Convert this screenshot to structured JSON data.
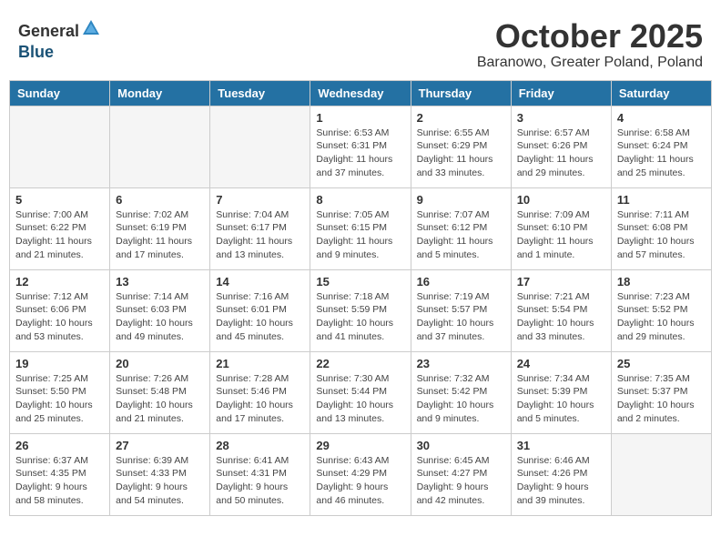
{
  "logo": {
    "general": "General",
    "blue": "Blue"
  },
  "title": "October 2025",
  "subtitle": "Baranowo, Greater Poland, Poland",
  "days_of_week": [
    "Sunday",
    "Monday",
    "Tuesday",
    "Wednesday",
    "Thursday",
    "Friday",
    "Saturday"
  ],
  "weeks": [
    [
      {
        "day": "",
        "info": ""
      },
      {
        "day": "",
        "info": ""
      },
      {
        "day": "",
        "info": ""
      },
      {
        "day": "1",
        "info": "Sunrise: 6:53 AM\nSunset: 6:31 PM\nDaylight: 11 hours\nand 37 minutes."
      },
      {
        "day": "2",
        "info": "Sunrise: 6:55 AM\nSunset: 6:29 PM\nDaylight: 11 hours\nand 33 minutes."
      },
      {
        "day": "3",
        "info": "Sunrise: 6:57 AM\nSunset: 6:26 PM\nDaylight: 11 hours\nand 29 minutes."
      },
      {
        "day": "4",
        "info": "Sunrise: 6:58 AM\nSunset: 6:24 PM\nDaylight: 11 hours\nand 25 minutes."
      }
    ],
    [
      {
        "day": "5",
        "info": "Sunrise: 7:00 AM\nSunset: 6:22 PM\nDaylight: 11 hours\nand 21 minutes."
      },
      {
        "day": "6",
        "info": "Sunrise: 7:02 AM\nSunset: 6:19 PM\nDaylight: 11 hours\nand 17 minutes."
      },
      {
        "day": "7",
        "info": "Sunrise: 7:04 AM\nSunset: 6:17 PM\nDaylight: 11 hours\nand 13 minutes."
      },
      {
        "day": "8",
        "info": "Sunrise: 7:05 AM\nSunset: 6:15 PM\nDaylight: 11 hours\nand 9 minutes."
      },
      {
        "day": "9",
        "info": "Sunrise: 7:07 AM\nSunset: 6:12 PM\nDaylight: 11 hours\nand 5 minutes."
      },
      {
        "day": "10",
        "info": "Sunrise: 7:09 AM\nSunset: 6:10 PM\nDaylight: 11 hours\nand 1 minute."
      },
      {
        "day": "11",
        "info": "Sunrise: 7:11 AM\nSunset: 6:08 PM\nDaylight: 10 hours\nand 57 minutes."
      }
    ],
    [
      {
        "day": "12",
        "info": "Sunrise: 7:12 AM\nSunset: 6:06 PM\nDaylight: 10 hours\nand 53 minutes."
      },
      {
        "day": "13",
        "info": "Sunrise: 7:14 AM\nSunset: 6:03 PM\nDaylight: 10 hours\nand 49 minutes."
      },
      {
        "day": "14",
        "info": "Sunrise: 7:16 AM\nSunset: 6:01 PM\nDaylight: 10 hours\nand 45 minutes."
      },
      {
        "day": "15",
        "info": "Sunrise: 7:18 AM\nSunset: 5:59 PM\nDaylight: 10 hours\nand 41 minutes."
      },
      {
        "day": "16",
        "info": "Sunrise: 7:19 AM\nSunset: 5:57 PM\nDaylight: 10 hours\nand 37 minutes."
      },
      {
        "day": "17",
        "info": "Sunrise: 7:21 AM\nSunset: 5:54 PM\nDaylight: 10 hours\nand 33 minutes."
      },
      {
        "day": "18",
        "info": "Sunrise: 7:23 AM\nSunset: 5:52 PM\nDaylight: 10 hours\nand 29 minutes."
      }
    ],
    [
      {
        "day": "19",
        "info": "Sunrise: 7:25 AM\nSunset: 5:50 PM\nDaylight: 10 hours\nand 25 minutes."
      },
      {
        "day": "20",
        "info": "Sunrise: 7:26 AM\nSunset: 5:48 PM\nDaylight: 10 hours\nand 21 minutes."
      },
      {
        "day": "21",
        "info": "Sunrise: 7:28 AM\nSunset: 5:46 PM\nDaylight: 10 hours\nand 17 minutes."
      },
      {
        "day": "22",
        "info": "Sunrise: 7:30 AM\nSunset: 5:44 PM\nDaylight: 10 hours\nand 13 minutes."
      },
      {
        "day": "23",
        "info": "Sunrise: 7:32 AM\nSunset: 5:42 PM\nDaylight: 10 hours\nand 9 minutes."
      },
      {
        "day": "24",
        "info": "Sunrise: 7:34 AM\nSunset: 5:39 PM\nDaylight: 10 hours\nand 5 minutes."
      },
      {
        "day": "25",
        "info": "Sunrise: 7:35 AM\nSunset: 5:37 PM\nDaylight: 10 hours\nand 2 minutes."
      }
    ],
    [
      {
        "day": "26",
        "info": "Sunrise: 6:37 AM\nSunset: 4:35 PM\nDaylight: 9 hours\nand 58 minutes."
      },
      {
        "day": "27",
        "info": "Sunrise: 6:39 AM\nSunset: 4:33 PM\nDaylight: 9 hours\nand 54 minutes."
      },
      {
        "day": "28",
        "info": "Sunrise: 6:41 AM\nSunset: 4:31 PM\nDaylight: 9 hours\nand 50 minutes."
      },
      {
        "day": "29",
        "info": "Sunrise: 6:43 AM\nSunset: 4:29 PM\nDaylight: 9 hours\nand 46 minutes."
      },
      {
        "day": "30",
        "info": "Sunrise: 6:45 AM\nSunset: 4:27 PM\nDaylight: 9 hours\nand 42 minutes."
      },
      {
        "day": "31",
        "info": "Sunrise: 6:46 AM\nSunset: 4:26 PM\nDaylight: 9 hours\nand 39 minutes."
      },
      {
        "day": "",
        "info": ""
      }
    ]
  ]
}
